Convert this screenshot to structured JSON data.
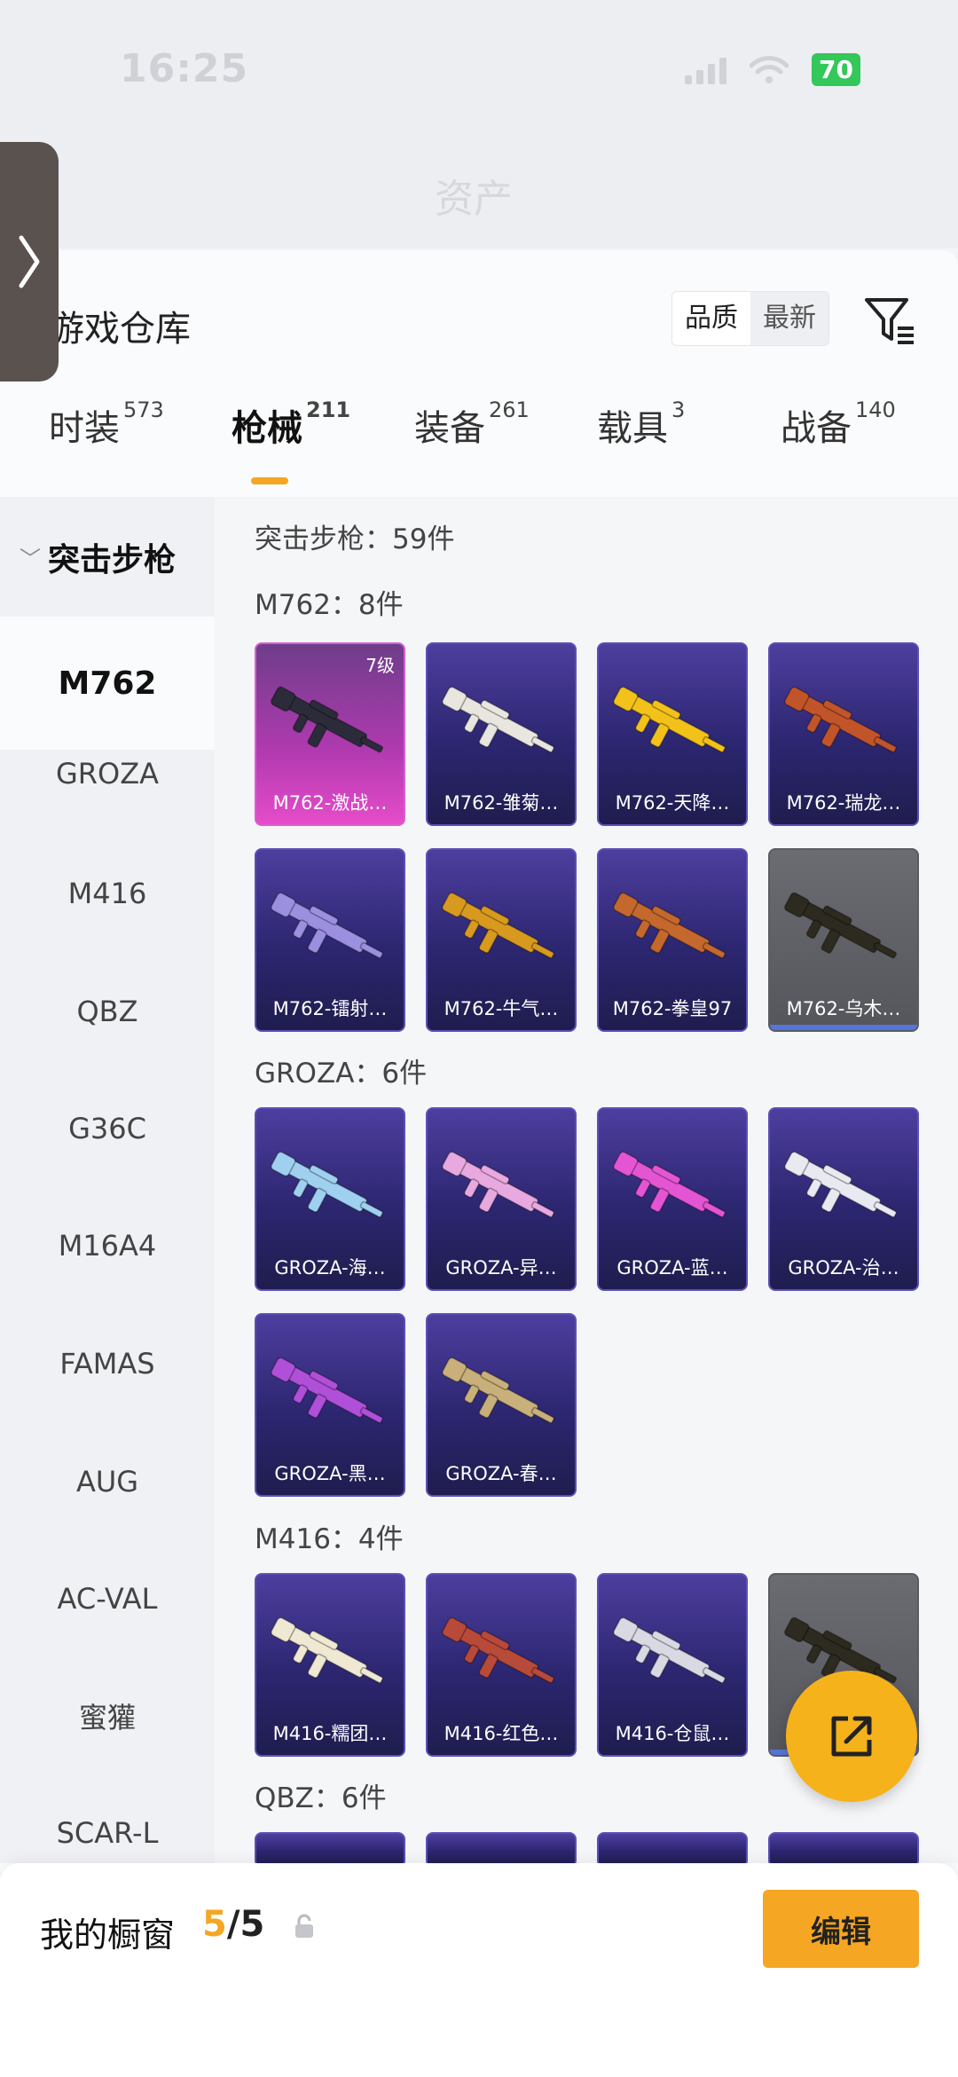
{
  "status_bar": {
    "time": "16:25",
    "battery": "70"
  },
  "header": {
    "title": "资产"
  },
  "panel": {
    "title": "游戏仓库",
    "sort_options": [
      {
        "label": "品质",
        "active": true
      },
      {
        "label": "最新",
        "active": false
      }
    ],
    "filter_icon": "filter-icon"
  },
  "categories": [
    {
      "label": "时装",
      "count": "573",
      "active": false
    },
    {
      "label": "枪械",
      "count": "211",
      "active": true
    },
    {
      "label": "装备",
      "count": "261",
      "active": false
    },
    {
      "label": "载具",
      "count": "3",
      "active": false
    },
    {
      "label": "战备",
      "count": "140",
      "active": false
    }
  ],
  "sidebar": {
    "group_label": "突击步枪",
    "items": [
      "M762",
      "GROZA",
      "M416",
      "QBZ",
      "G36C",
      "M16A4",
      "FAMAS",
      "AUG",
      "AC-VAL",
      "蜜獾",
      "SCAR-L"
    ],
    "active_index": 0
  },
  "content": {
    "summary": "突击步枪：59件",
    "sections": [
      {
        "header": "M762：8件",
        "items": [
          {
            "label": "M762-激战…",
            "badge": "7级",
            "style": "pink",
            "gun_color": "#2b2b3a"
          },
          {
            "label": "M762-雏菊…",
            "style": "purple",
            "gun_color": "#e8e6df"
          },
          {
            "label": "M762-天降…",
            "style": "purple",
            "gun_color": "#f2c21b"
          },
          {
            "label": "M762-瑞龙…",
            "style": "purple",
            "gun_color": "#c2542a"
          },
          {
            "label": "M762-镭射…",
            "style": "purple",
            "gun_color": "#9b8fe0"
          },
          {
            "label": "M762-牛气…",
            "style": "purple",
            "gun_color": "#d79a1f"
          },
          {
            "label": "M762-拳皇97",
            "style": "purple",
            "gun_color": "#c4682d"
          },
          {
            "label": "M762-乌木…",
            "style": "gray",
            "gun_color": "#2d2a1f"
          }
        ]
      },
      {
        "header": "GROZA：6件",
        "items": [
          {
            "label": "GROZA-海…",
            "style": "purple",
            "gun_color": "#9fd0f0"
          },
          {
            "label": "GROZA-异…",
            "style": "purple",
            "gun_color": "#e8a9e0"
          },
          {
            "label": "GROZA-蓝…",
            "style": "purple",
            "gun_color": "#e455d4"
          },
          {
            "label": "GROZA-治…",
            "style": "purple",
            "gun_color": "#e9e9f2"
          },
          {
            "label": "GROZA-黑…",
            "style": "purple",
            "gun_color": "#b04fd8"
          },
          {
            "label": "GROZA-春…",
            "style": "purple",
            "gun_color": "#c9b07a"
          }
        ]
      },
      {
        "header": "M416：4件",
        "items": [
          {
            "label": "M416-糯团…",
            "style": "purple",
            "gun_color": "#efe8d2"
          },
          {
            "label": "M416-红色…",
            "style": "purple",
            "gun_color": "#b84a3a"
          },
          {
            "label": "M416-仓鼠…",
            "style": "purple",
            "gun_color": "#d9d9e3"
          },
          {
            "label": "",
            "style": "gray",
            "gun_color": "#2d2a1f"
          }
        ]
      },
      {
        "header": "QBZ：6件",
        "items": []
      }
    ]
  },
  "fab": {
    "icon": "share-icon"
  },
  "bottom_bar": {
    "label": "我的橱窗",
    "current": "5",
    "total": "/5",
    "lock_icon": "lock-icon",
    "edit_label": "编辑"
  },
  "colors": {
    "accent": "#f5a623",
    "fab": "#f6b21a"
  }
}
